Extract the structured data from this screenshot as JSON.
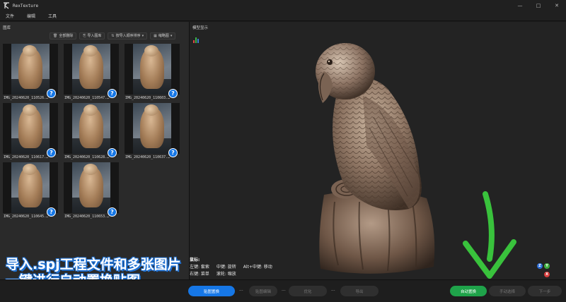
{
  "window": {
    "title": "RexTexture",
    "minimize_label": "—",
    "maximize_label": "□",
    "close_label": "✕"
  },
  "menu": {
    "items": [
      {
        "label": "文件"
      },
      {
        "label": "编辑"
      },
      {
        "label": "工具"
      }
    ]
  },
  "gallery": {
    "title": "图库",
    "toolbar": {
      "delete_all_label": "全部删除",
      "import_label": "导入图库",
      "sort_label": "按导入顺序排序",
      "view_label": "缩略图"
    },
    "images": [
      {
        "name": "IMG_20240620_110526.…",
        "status": "?"
      },
      {
        "name": "IMG_20240620_110547.…",
        "status": "?"
      },
      {
        "name": "IMG_20240620_110603.…",
        "status": "?"
      },
      {
        "name": "IMG_20240620_110617.…",
        "status": "?"
      },
      {
        "name": "IMG_20240620_110628.…",
        "status": "?"
      },
      {
        "name": "IMG_20240620_110637.…",
        "status": "?"
      },
      {
        "name": "IMG_20240620_110645.…",
        "status": "?"
      },
      {
        "name": "IMG_20240620_110653.…",
        "status": "?"
      }
    ]
  },
  "promo": {
    "line1": "导入.spj工程文件和多张图片",
    "line2": "一键进行自动置换贴图"
  },
  "viewport": {
    "title": "模型显示",
    "mouse_help": {
      "title": "鼠标:",
      "row1": {
        "left": "左键: 套索",
        "middle": "中键: 旋转",
        "alt": "Alt+中键: 移动"
      },
      "row2": {
        "right": "右键: 菜单",
        "wheel": "滚轮: 缩放"
      }
    },
    "axes": {
      "x": "X",
      "y": "Y",
      "z": "Z"
    }
  },
  "steps": {
    "texture_replace": "贴图置换",
    "texture_edit": "贴图编辑",
    "optimize": "优化",
    "export": "导出",
    "auto_replace": "自动置换",
    "manual_select": "手动选择",
    "next": "下一步",
    "dots": "···"
  },
  "colors": {
    "accent_blue": "#1677e6",
    "accent_green": "#1fa34a",
    "arrow_green": "#39c23c"
  }
}
